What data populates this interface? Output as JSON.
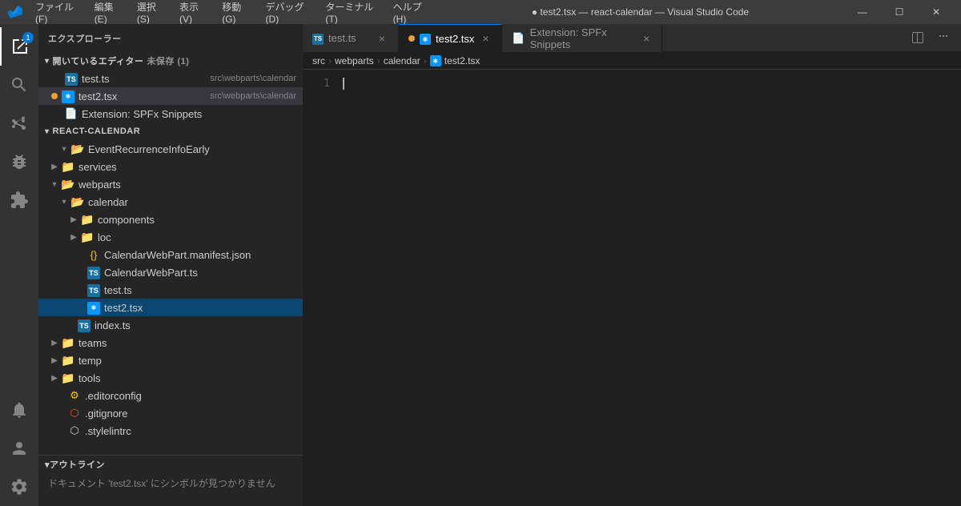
{
  "titlebar": {
    "logo": "VS",
    "menus": [
      "ファイル(F)",
      "編集(E)",
      "選択(S)",
      "表示(V)",
      "移動(G)",
      "デバッグ(D)",
      "ターミナル(T)",
      "ヘルプ(H)"
    ],
    "title": "● test2.tsx — react-calendar — Visual Studio Code",
    "controls": [
      "—",
      "☐",
      "✕"
    ]
  },
  "sidebar": {
    "title": "エクスプローラー",
    "open_editors_section": "開いているエディター",
    "open_editors_badge": "未保存 (1)",
    "open_editors_files": [
      {
        "icon": "ts",
        "name": "test.ts",
        "path": "src\\webparts\\calendar"
      },
      {
        "icon": "tsx",
        "name": "test2.tsx",
        "path": "src\\webparts\\calendar",
        "modified": true
      },
      {
        "icon": "generic",
        "name": "Extension: SPFx Snippets"
      }
    ],
    "project_section": "REACT-CALENDAR",
    "tree": [
      {
        "indent": 4,
        "type": "folder-open",
        "color": "special",
        "name": "EventRecurrenceInfoEarly",
        "collapsed": false,
        "truncated": true
      },
      {
        "indent": 2,
        "type": "folder-closed",
        "color": "special",
        "name": "services",
        "has_arrow": true
      },
      {
        "indent": 2,
        "type": "folder-open",
        "color": "normal",
        "name": "webparts",
        "has_arrow": true,
        "expanded": true
      },
      {
        "indent": 4,
        "type": "folder-open",
        "color": "normal",
        "name": "calendar",
        "has_arrow": true,
        "expanded": true
      },
      {
        "indent": 6,
        "type": "folder-closed",
        "color": "special",
        "name": "components",
        "has_arrow": true
      },
      {
        "indent": 6,
        "type": "folder-closed",
        "color": "normal",
        "name": "loc",
        "has_arrow": true
      },
      {
        "indent": 6,
        "type": "json",
        "name": "CalendarWebPart.manifest.json"
      },
      {
        "indent": 6,
        "type": "ts",
        "name": "CalendarWebPart.ts"
      },
      {
        "indent": 6,
        "type": "ts",
        "name": "test.ts"
      },
      {
        "indent": 6,
        "type": "tsx-active",
        "name": "test2.tsx",
        "selected": true
      },
      {
        "indent": 4,
        "type": "ts",
        "name": "index.ts"
      },
      {
        "indent": 2,
        "type": "folder-closed",
        "color": "normal",
        "name": "teams",
        "has_arrow": true
      },
      {
        "indent": 2,
        "type": "folder-closed",
        "color": "special",
        "name": "temp",
        "has_arrow": true
      },
      {
        "indent": 2,
        "type": "folder-closed",
        "color": "special",
        "name": "tools",
        "has_arrow": true
      },
      {
        "indent": 2,
        "type": "editorconfig",
        "name": ".editorconfig"
      },
      {
        "indent": 2,
        "type": "gitignore",
        "name": ".gitignore"
      },
      {
        "indent": 2,
        "type": "stylelint",
        "name": ".stylelintrc"
      }
    ],
    "outline_section": "アウトライン",
    "outline_content": "ドキュメント 'test2.tsx' にシンボルが見つかりません"
  },
  "tabs": [
    {
      "icon": "ts",
      "name": "test.ts",
      "active": false
    },
    {
      "icon": "tsx",
      "name": "test2.tsx",
      "active": true,
      "modified": true
    },
    {
      "icon": "generic",
      "name": "Extension: SPFx Snippets",
      "active": false
    }
  ],
  "breadcrumb": [
    "src",
    "webparts",
    "calendar",
    "test2.tsx"
  ],
  "editor": {
    "line_number": "1",
    "content": ""
  },
  "activity": {
    "icons": [
      "📁",
      "🔍",
      "⎇",
      "🐛",
      "🧩",
      "🔔",
      "👤"
    ]
  }
}
